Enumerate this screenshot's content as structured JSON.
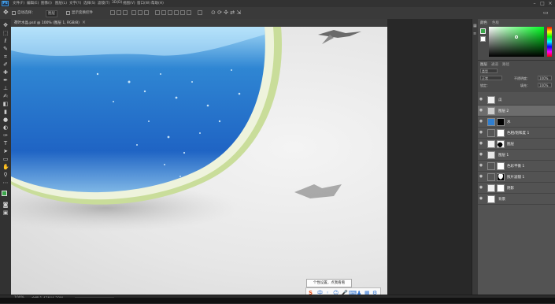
{
  "menu": {
    "items": [
      "文件(F)",
      "编辑(E)",
      "图像(I)",
      "图层(L)",
      "文字(Y)",
      "选择(S)",
      "滤镜(T)",
      "3D(D)",
      "视图(V)",
      "窗口(W)",
      "帮助(H)"
    ]
  },
  "options": {
    "auto_select": "自动选择：",
    "auto_select_value": "图层",
    "show_transform": "显示变换控件"
  },
  "document": {
    "tab_title": "荷叶水晶.psd @ 100% (图层 1, RGB/8)",
    "close": "×"
  },
  "status": {
    "zoom": "100%",
    "doc_size": "文档:1.43M/4.28M"
  },
  "panels": {
    "color_tab": "颜色",
    "swatches_tab": "色板",
    "layers_tab": "图层",
    "channels_tab": "通道",
    "paths_tab": "路径",
    "kind_filter": "类型",
    "blend_mode": "正常",
    "opacity_label": "不透明度：",
    "opacity_value": "100%",
    "lock_label": "锁定：",
    "fill_label": "填充：",
    "fill_value": "100%"
  },
  "layers": [
    {
      "name": "瓜",
      "has_mask": false
    },
    {
      "name": "图层 2",
      "has_mask": false,
      "selected": true
    },
    {
      "name": "水",
      "has_mask": true
    },
    {
      "name": "色相/饱和度 1",
      "has_mask": true
    },
    {
      "name": "图层",
      "has_mask": true
    },
    {
      "name": "图层 1",
      "has_mask": false
    },
    {
      "name": "色彩平衡 1",
      "has_mask": true
    },
    {
      "name": "照片滤镜 1",
      "has_mask": true
    },
    {
      "name": "阴影",
      "has_mask": true
    },
    {
      "name": "背景",
      "has_mask": false
    }
  ],
  "tooltip": "个性设置，点我看看",
  "ime": {
    "logo": "S",
    "lang": "中"
  },
  "colors": {
    "foreground": "#3aa64a",
    "background": "#ffffff",
    "picker_hue": "#00ff22"
  }
}
